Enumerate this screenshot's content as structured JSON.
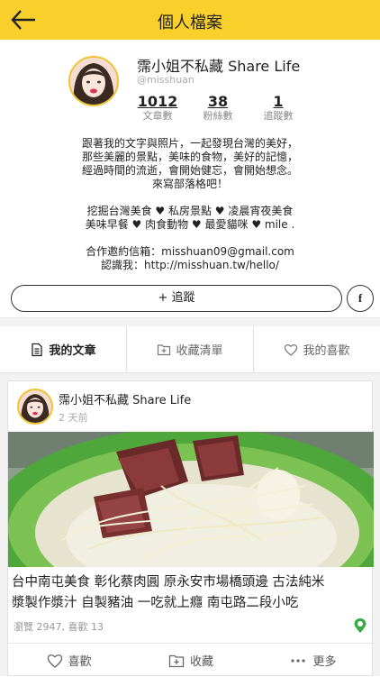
{
  "header": {
    "title": "個人檔案",
    "back_icon": "arrow-left-icon"
  },
  "profile": {
    "name": "霈小姐不私藏 Share Life",
    "handle": "@misshuan",
    "stats": [
      {
        "value": "1012",
        "label": "文章數"
      },
      {
        "value": "38",
        "label": "粉絲數"
      },
      {
        "value": "1",
        "label": "追蹤數"
      }
    ],
    "bio_lines": [
      "跟著我的文字與照片，一起發現台灣的美好，",
      "那些美麗的景點，美味的食物，美好的記憶，",
      "經過時間的流逝，會開始健忘，會開始想念。",
      "來寫部落格吧！",
      "",
      "挖掘台灣美食 ♥ 私房景點 ♥ 凌晨宵夜美食",
      "美味早餐 ♥ 肉食動物 ♥ 最愛貓咪 ♥ mile .",
      "",
      "合作邀約信箱：misshuan09@gmail.com",
      "認識我：http://misshuan.tw/hello/"
    ],
    "follow_label": "+ 追蹤",
    "facebook_label": "f"
  },
  "tabs": [
    {
      "label": "我的文章",
      "icon": "document-icon",
      "active": true
    },
    {
      "label": "收藏清單",
      "icon": "folder-add-icon",
      "active": false
    },
    {
      "label": "我的喜歡",
      "icon": "heart-outline-icon",
      "active": false
    }
  ],
  "post": {
    "author": "霈小姐不私藏 Share Life",
    "time": "2 天前",
    "title_lines": [
      "台中南屯美食 彰化蔡肉圓 原永安市場橋頭邊 古法純米",
      "漿製作漿汁 自製豬油 一吃就上癮 南屯路二段小吃"
    ],
    "stats": "瀏覽 2947, 喜歡 13",
    "actions": [
      {
        "label": "喜歡",
        "icon": "heart-outline-icon"
      },
      {
        "label": "收藏",
        "icon": "folder-add-icon"
      },
      {
        "label": "更多",
        "icon": "more-dots-icon"
      }
    ]
  },
  "colors": {
    "accent": "#f9cf2c",
    "background": "#f2f2f2"
  }
}
